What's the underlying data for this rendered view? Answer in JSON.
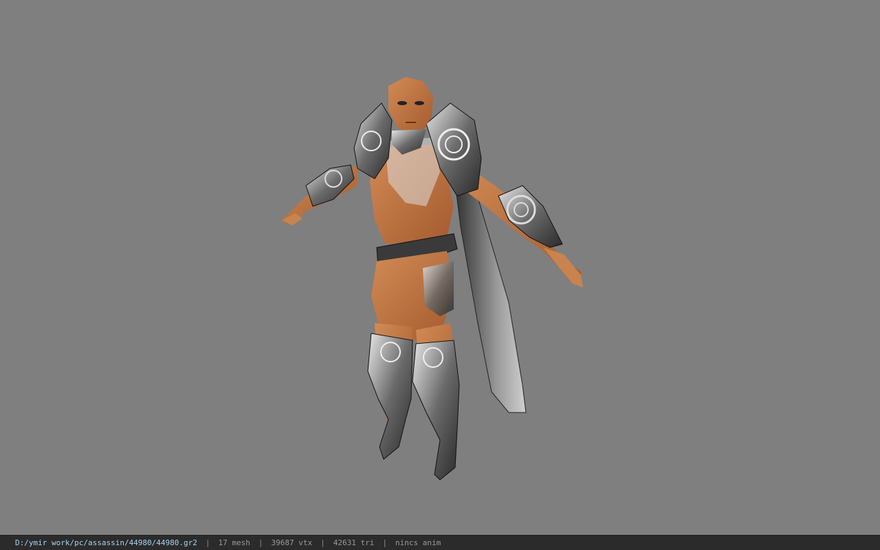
{
  "viewport": {
    "background_color": "#7f7f7f",
    "model_name": "assassin character model"
  },
  "status": {
    "file_path": "D:/ymir work/pc/assassin/44980/44980.gr2",
    "separator": "|",
    "mesh": "17 mesh",
    "vertices": "39687 vtx",
    "triangles": "42631 tri",
    "animation": "nincs anim",
    "path_color": "#a9d4f0",
    "bar_color": "#2b2b2b"
  }
}
